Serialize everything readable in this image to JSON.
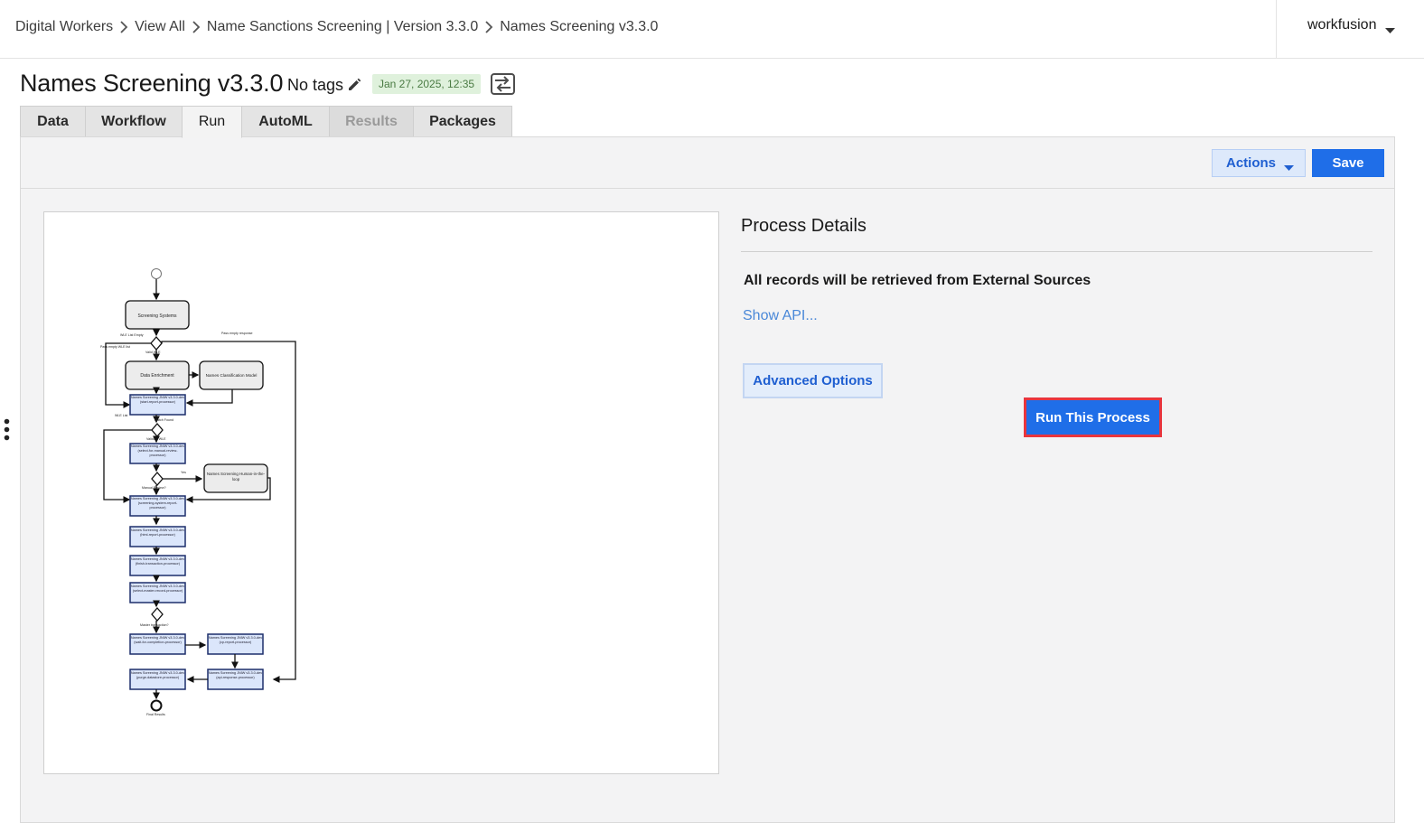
{
  "breadcrumb": [
    "Digital Workers",
    "View All",
    "Name Sanctions Screening | Version 3.3.0",
    "Names Screening v3.3.0"
  ],
  "user": {
    "name": "workfusion"
  },
  "header": {
    "title": "Names Screening v3.3.0",
    "tags_label": "No tags",
    "date": "Jan 27, 2025, 12:35"
  },
  "tabs": [
    {
      "label": "Data",
      "state": "normal"
    },
    {
      "label": "Workflow",
      "state": "normal"
    },
    {
      "label": "Run",
      "state": "active"
    },
    {
      "label": "AutoML",
      "state": "normal"
    },
    {
      "label": "Results",
      "state": "disabled"
    },
    {
      "label": "Packages",
      "state": "normal"
    }
  ],
  "toolbar": {
    "actions_label": "Actions",
    "save_label": "Save"
  },
  "details": {
    "title": "Process Details",
    "text": "All records will be retrieved from External Sources",
    "show_api": "Show API...",
    "advanced_label": "Advanced Options",
    "run_label": "Run This Process"
  },
  "diagram": {
    "nodes": {
      "screening": "Screening Systems",
      "enrich": "Data Enrichment",
      "classify": "Names Classification Model",
      "s1": "Names Screening JNIW v3.3.0-dev (start-report-processor)",
      "s2": "Names Screening JNIW v3.3.0-dev (select-for-manual-review-processor)",
      "human": "Names Screening Human-in-the-loop",
      "s3": "Names Screening JNIW v3.3.0-dev (screening-system-report-processor)",
      "s4": "Names Screening JNIW v3.3.0-dev (html-report-processor)",
      "s5": "Names Screening JNIW v3.3.0-dev (finish-transaction-processor)",
      "s6": "Names Screening JNIW v3.3.0-dev (select-master-record-processor)",
      "s7": "Names Screening JNIW v3.3.0-dev (wait-for-completion-processor)",
      "s8": "Names Screening JNIW v3.3.0-dev (cp-report-processor)",
      "s9": "Names Screening JNIW v3.3.0-dev (purge-datastore-processor)",
      "s10": "Names Screening JNIW v3.3.0-dev (api-response-processor)",
      "final": "Final Results"
    },
    "labels": {
      "wle_empty": "WLE List Empty",
      "pass_empty": "Pass empty WLE list",
      "pass_empty_resp": "Pass empty response",
      "valid": "Valid WLE",
      "wle_list": "WLE List",
      "match_found": "Match Found",
      "validate": "Validate WLE",
      "yes": "Yes",
      "manual": "Manual Review?",
      "master": "Master transaction?"
    },
    "colors": {
      "process_fill": "#dbe6fb",
      "process_stroke": "#1d2f6b",
      "task_fill": "#ececec"
    }
  }
}
